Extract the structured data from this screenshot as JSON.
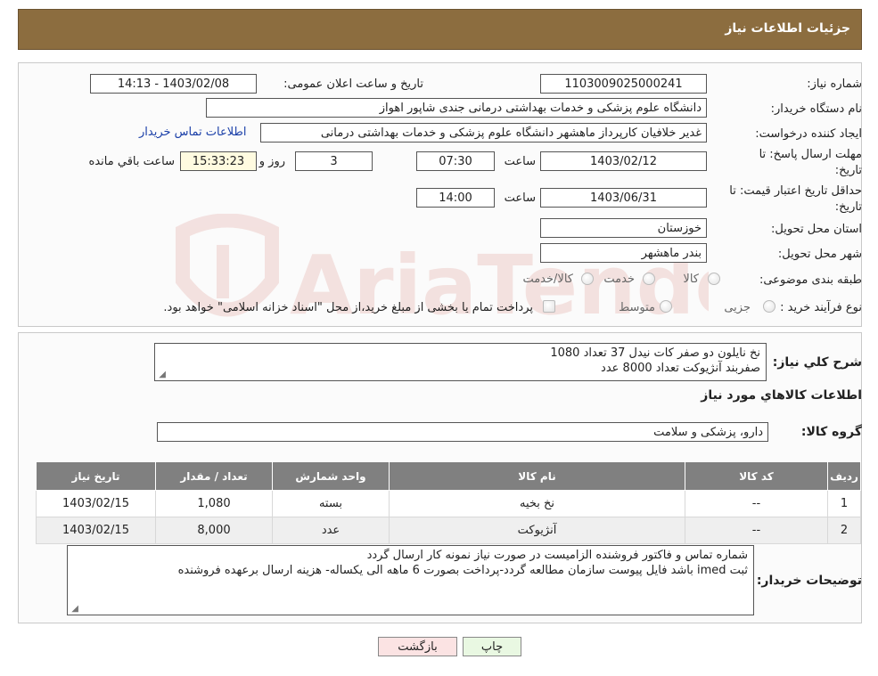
{
  "header": {
    "title": "جزئیات اطلاعات نیاز"
  },
  "form": {
    "need_number_label": "شماره نیاز:",
    "need_number": "1103009025000241",
    "announce_label": "تاریخ و ساعت اعلان عمومی:",
    "announce_value": "1403/02/08 - 14:13",
    "buyer_org_label": "نام دستگاه خریدار:",
    "buyer_org": "دانشگاه علوم پزشکی و خدمات بهداشتی درمانی جندی شاپور اهواز",
    "creator_label": "ایجاد کننده درخواست:",
    "creator": "غدیر خلافیان کارپرداز ماهشهر دانشگاه علوم پزشکی و خدمات بهداشتی درمانی",
    "contact_link": "اطلاعات تماس خریدار",
    "deadline_label_1": "مهلت ارسال پاسخ: تا",
    "deadline_label_2": "تاریخ:",
    "deadline_date": "1403/02/12",
    "time_label": "ساعت",
    "deadline_time": "07:30",
    "days": "3",
    "days_label": "روز و",
    "remaining": "15:33:23",
    "remaining_label": "ساعت باقي مانده",
    "validity_label_1": "حداقل تاریخ اعتبار قیمت: تا",
    "validity_label_2": "تاریخ:",
    "validity_date": "1403/06/31",
    "validity_time": "14:00",
    "province_label": "استان محل تحویل:",
    "province": "خوزستان",
    "city_label": "شهر محل تحویل:",
    "city": "بندر ماهشهر",
    "category_label": "طبقه بندی موضوعی:",
    "category_options": [
      "کالا",
      "خدمت",
      "کالا/خدمت"
    ],
    "process_label": "نوع فرآیند خرید :",
    "process_options": [
      "جزیی",
      "متوسط"
    ],
    "process_note": "پرداخت تمام یا بخشی از مبلغ خرید،از محل \"اسناد خزانه اسلامی\" خواهد بود."
  },
  "summary": {
    "label": "شرح کلي نياز:",
    "lines": [
      "نخ نایلون دو صفر کات نیدل 37 تعداد 1080",
      "صفربند آنژیوکت تعداد 8000 عدد"
    ]
  },
  "goods": {
    "section_title": "اطلاعات کالاهاي مورد نياز",
    "group_label": "گروه کالا:",
    "group_value": "دارو، پزشکی و سلامت"
  },
  "table": {
    "headers": [
      "رديف",
      "کد کالا",
      "نام کالا",
      "واحد شمارش",
      "تعداد / مقدار",
      "تاریخ نیاز"
    ],
    "rows": [
      [
        "1",
        "--",
        "نخ بخیه",
        "بسته",
        "1,080",
        "1403/02/15"
      ],
      [
        "2",
        "--",
        "آنژیوکت",
        "عدد",
        "8,000",
        "1403/02/15"
      ]
    ]
  },
  "notes": {
    "label": "توضیحات خریدار:",
    "lines": [
      "شماره تماس و فاکتور فروشنده الزامیست در صورت نیاز نمونه کار ارسال گردد",
      "ثبت imed باشد فایل پیوست سازمان مطالعه گردد-پرداخت بصورت 6 ماهه الی یکساله- هزینه ارسال برعهده فروشنده"
    ]
  },
  "buttons": {
    "print": "چاپ",
    "back": "بازگشت"
  },
  "watermark": {
    "text": "AriaTender.neT"
  }
}
